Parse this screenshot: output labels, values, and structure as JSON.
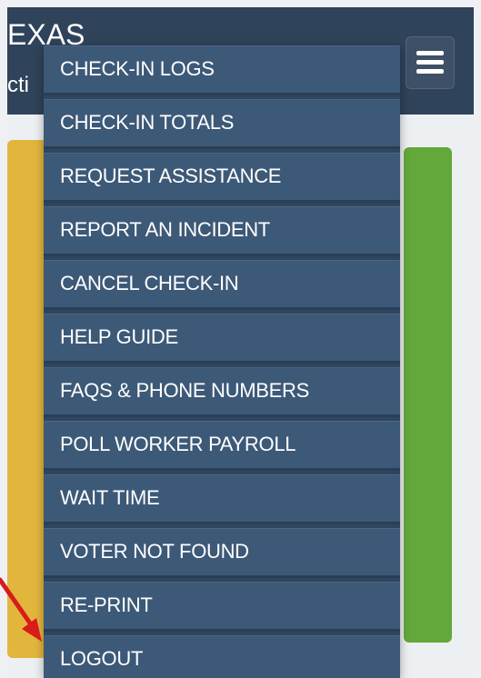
{
  "header": {
    "title": "EXAS",
    "subtitle": "cti"
  },
  "menu": {
    "items": [
      {
        "label": "CHECK-IN LOGS",
        "id": "check-in-logs"
      },
      {
        "label": "CHECK-IN TOTALS",
        "id": "check-in-totals"
      },
      {
        "label": "REQUEST ASSISTANCE",
        "id": "request-assistance"
      },
      {
        "label": "REPORT AN INCIDENT",
        "id": "report-an-incident"
      },
      {
        "label": "CANCEL CHECK-IN",
        "id": "cancel-check-in"
      },
      {
        "label": "HELP GUIDE",
        "id": "help-guide"
      },
      {
        "label": "FAQS & PHONE NUMBERS",
        "id": "faqs-phone-numbers"
      },
      {
        "label": "POLL WORKER PAYROLL",
        "id": "poll-worker-payroll"
      },
      {
        "label": "WAIT TIME",
        "id": "wait-time"
      },
      {
        "label": "VOTER NOT FOUND",
        "id": "voter-not-found"
      },
      {
        "label": "RE-PRINT",
        "id": "re-print"
      },
      {
        "label": "LOGOUT",
        "id": "logout"
      }
    ]
  },
  "colors": {
    "header_bg": "#2f435a",
    "menu_item_bg": "#3d5978",
    "tile_yellow": "#e2b63d",
    "tile_green": "#63a83a",
    "annotation_arrow": "#d81b1b"
  },
  "icons": {
    "menu_toggle": "hamburger-menu-icon",
    "annotation": "red-arrow-icon"
  }
}
